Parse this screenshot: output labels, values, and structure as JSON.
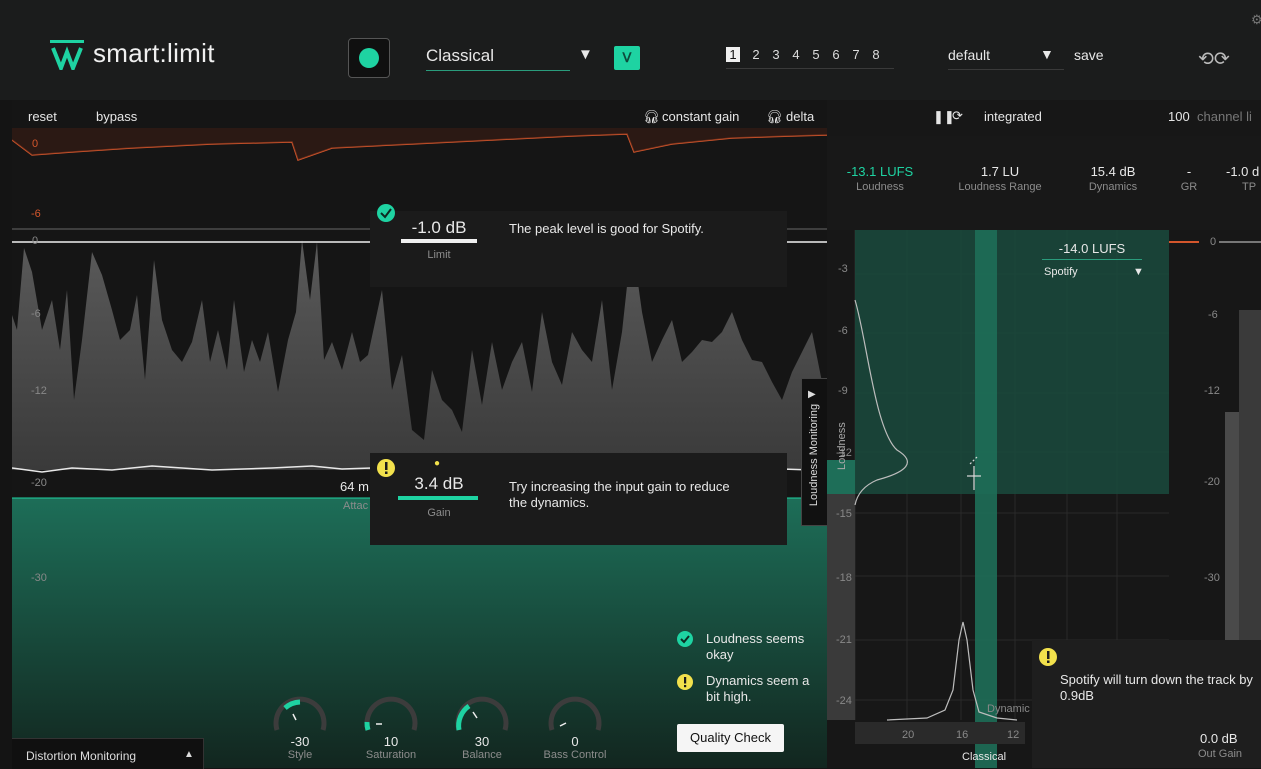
{
  "header": {
    "logo_text": "smart:limit",
    "profile": "Classical",
    "presets": [
      "1",
      "2",
      "3",
      "4",
      "5",
      "6",
      "7",
      "8"
    ],
    "preset_default": "default",
    "save_label": "save"
  },
  "toolbar": {
    "reset": "reset",
    "bypass": "bypass",
    "constant_gain": "constant gain",
    "delta": "delta",
    "integrated": "integrated",
    "channel_link_value": "100",
    "channel_link_label": "channel li"
  },
  "stats": [
    {
      "value": "-13.1 LUFS",
      "label": "Loudness",
      "color": "#1ed3a2"
    },
    {
      "value": "1.7 LU",
      "label": "Loudness Range",
      "color": "#e8e8e8"
    },
    {
      "value": "15.4 dB",
      "label": "Dynamics",
      "color": "#e8e8e8"
    },
    {
      "value": "-",
      "label": "GR",
      "color": "#e8e8e8"
    },
    {
      "value": "-1.0 d",
      "label": "TP",
      "color": "#e8e8e8"
    }
  ],
  "graph_scale": {
    "top_0": "0",
    "top_m6": "-6",
    "left": [
      "0",
      "-6",
      "-12",
      "-20",
      "-30"
    ]
  },
  "limit_panel": {
    "value": "-1.0 dB",
    "label": "Limit",
    "message": "The peak level is good for Spotify."
  },
  "gain_panel": {
    "value": "3.4 dB",
    "label": "Gain",
    "message": "Try increasing the input gain to reduce the dynamics.",
    "attack_value": "64 m",
    "attack_label": "Attac"
  },
  "loudness": {
    "target_value": "-14.0 LUFS",
    "target_platform": "Spotify",
    "monitor_tab": "Loudness Monitoring",
    "vertical_label": "Loudness",
    "scale": [
      "-3",
      "-6",
      "-9",
      "-12",
      "-15",
      "-18",
      "-21",
      "-24"
    ],
    "bottom_scale": [
      "20",
      "16",
      "12"
    ],
    "classical_label": "Classical",
    "dynamic_label": "Dynamic"
  },
  "right_meter": {
    "scale": [
      "0",
      "-6",
      "-12",
      "-20",
      "-30"
    ],
    "out_gain_value": "0.0 dB",
    "out_gain_label": "Out Gain"
  },
  "quality": {
    "loudness_msg": "Loudness seems okay",
    "dynamics_msg": "Dynamics seem a bit high.",
    "button": "Quality Check"
  },
  "spotify_tip": "Spotify will turn down the track by 0.9dB",
  "knobs": [
    {
      "value": "-30",
      "label": "Style"
    },
    {
      "value": "10",
      "label": "Saturation"
    },
    {
      "value": "30",
      "label": "Balance"
    },
    {
      "value": "0",
      "label": "Bass Control"
    }
  ],
  "distortion": {
    "label": "Distortion Monitoring"
  },
  "colors": {
    "accent": "#1ed3a2",
    "warning": "#f2e14c",
    "gr_curve": "#d4562c"
  }
}
